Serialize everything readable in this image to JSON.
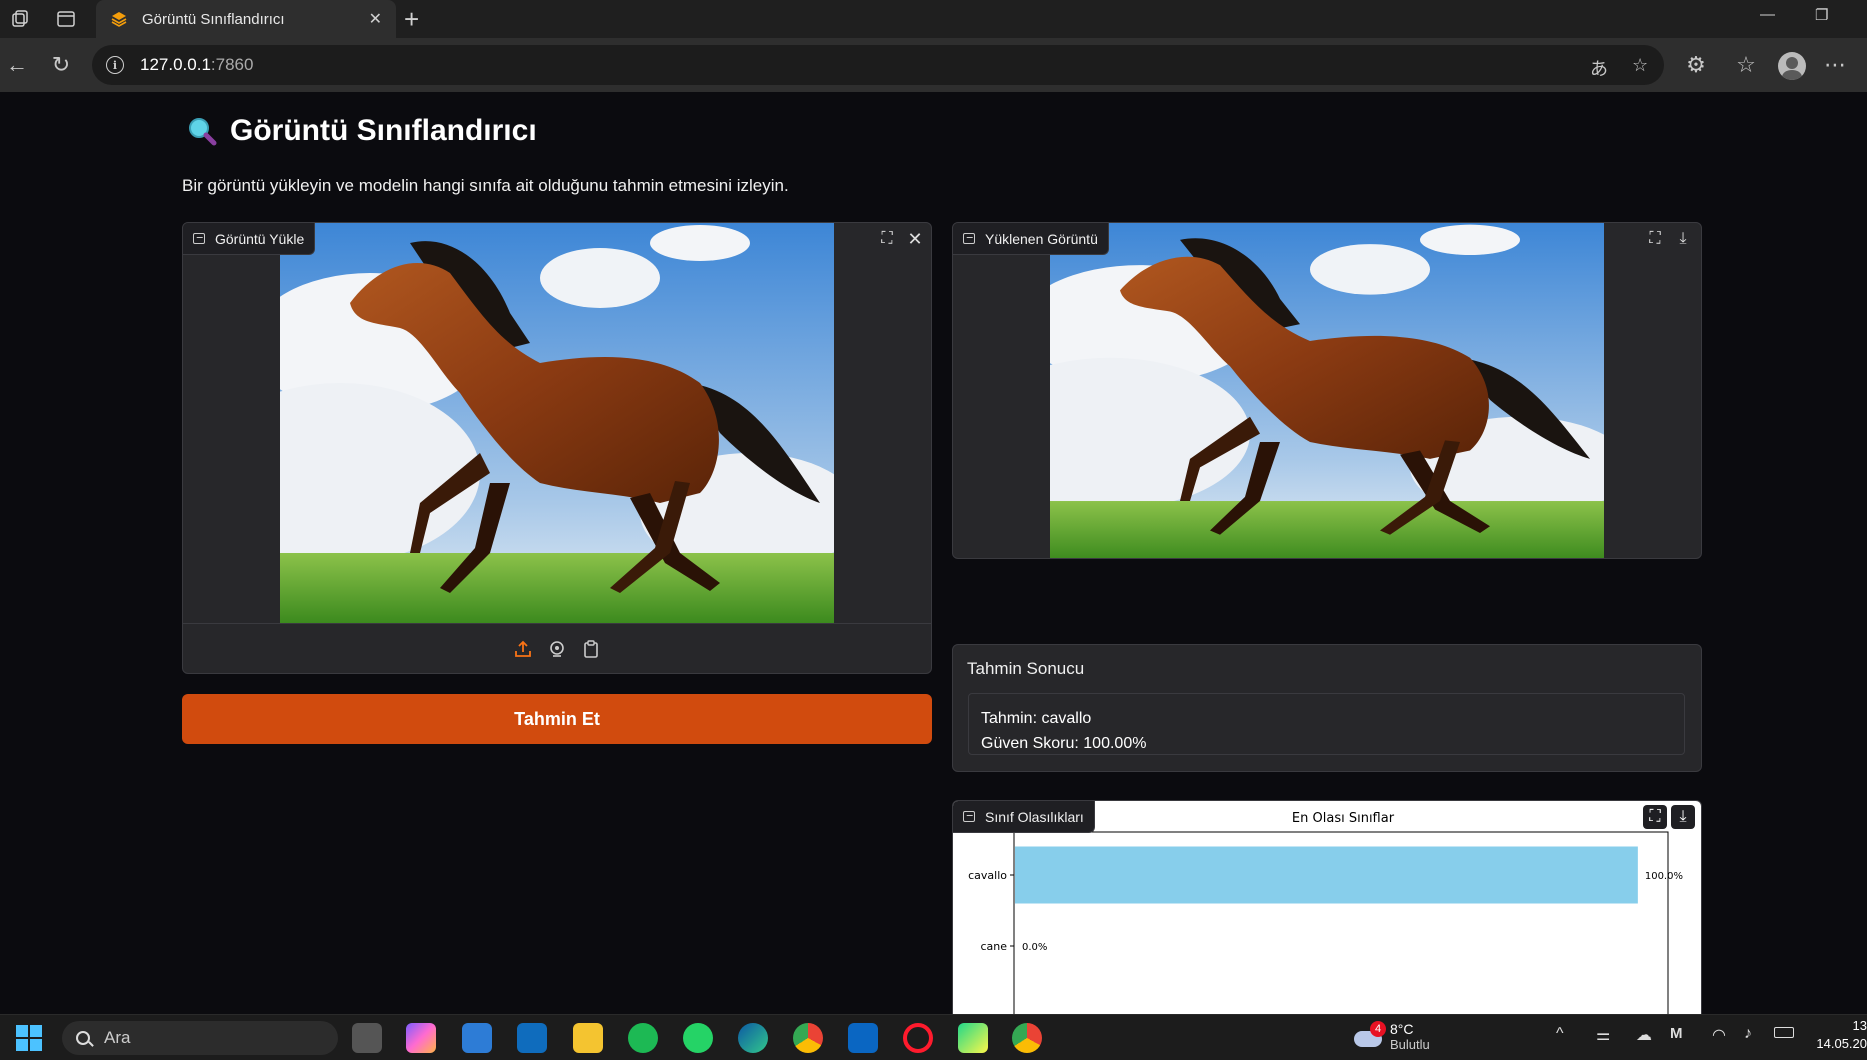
{
  "browser": {
    "tab_title": "Görüntü Sınıflandırıcı",
    "url_host": "127.0.0.1",
    "url_port": ":7860"
  },
  "page": {
    "title": "Görüntü Sınıflandırıcı",
    "description": "Bir görüntü yükleyin ve modelin hangi sınıfa ait olduğunu tahmin etmesini izleyin.",
    "upload_label": "Görüntü Yükle",
    "uploaded_label": "Yüklenen Görüntü",
    "predict_button": "Tahmin Et",
    "result_title": "Tahmin Sonucu",
    "result_line1": "Tahmin: cavallo",
    "result_line2": "Güven Skoru: 100.00%",
    "probs_label": "Sınıf Olasılıkları"
  },
  "chart_data": {
    "type": "bar",
    "orientation": "horizontal",
    "title": "En Olası Sınıflar",
    "categories": [
      "cavallo",
      "cane"
    ],
    "values": [
      100.0,
      0.0
    ],
    "value_labels": [
      "100.0%",
      "0.0%"
    ],
    "xlim": [
      0,
      105
    ],
    "bar_color": "#87ceeb"
  },
  "taskbar": {
    "search_placeholder": "Ara",
    "weather_temp": "8°C",
    "weather_desc": "Bulutlu",
    "weather_badge": "4",
    "time": "13",
    "date": "14.05.20"
  }
}
